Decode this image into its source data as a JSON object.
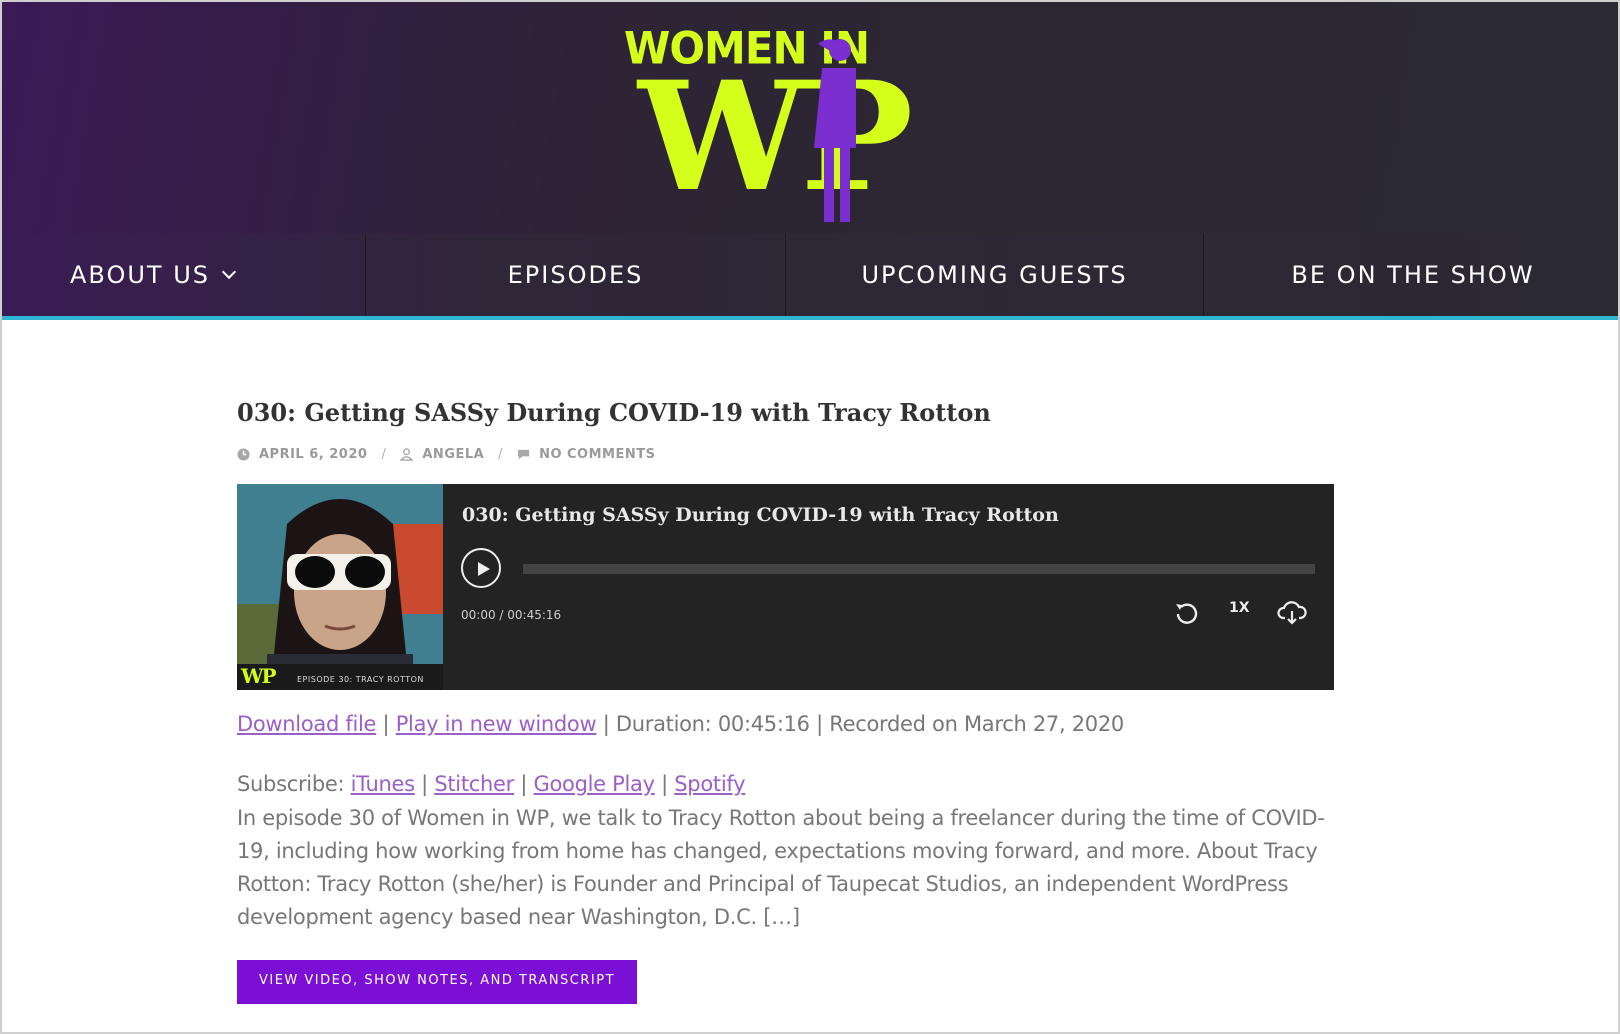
{
  "header": {
    "logo_small_text": "WOMEN IN",
    "logo_big_text": "WP",
    "colors": {
      "logo_green": "#d4ff1a",
      "logo_purple": "#7b2fd0",
      "accent_line": "#2fb6d2"
    }
  },
  "nav": {
    "items": [
      {
        "label": "ABOUT US",
        "has_dropdown": true
      },
      {
        "label": "EPISODES"
      },
      {
        "label": "UPCOMING GUESTS"
      },
      {
        "label": "BE ON THE SHOW"
      }
    ]
  },
  "post": {
    "title": "030: Getting SASSy During COVID-19 with Tracy Rotton",
    "date": "APRIL 6, 2020",
    "author": "ANGELA",
    "comments": "NO COMMENTS",
    "icons": {
      "date": "clock-icon",
      "author": "user-icon",
      "comments": "comment-icon"
    }
  },
  "player": {
    "title": "030: Getting SASSy During COVID-19 with Tracy Rotton",
    "time_display": "00:00 / 00:45:16",
    "speed": "1X",
    "progress": 0,
    "cover_caption": "EPISODE 30: TRACY ROTTON",
    "cover_logo": "WP",
    "icons": {
      "play": "play-icon",
      "rewind": "replay-icon",
      "download": "cloud-download-icon"
    }
  },
  "links": {
    "download": "Download file",
    "sep1": " | ",
    "play_new": "Play in new window",
    "rest": " | Duration: 00:45:16 | Recorded on March 27, 2020"
  },
  "subscribe": {
    "label": "Subscribe: ",
    "itunes": "iTunes",
    "stitcher": "Stitcher",
    "google": "Google Play",
    "spotify": "Spotify",
    "sep": " | "
  },
  "description": "In episode 30 of Women in WP, we talk to Tracy Rotton about being a freelancer during the time of COVID-19, including how working from home has changed, expectations moving forward, and more. About Tracy Rotton: Tracy Rotton (she/her) is Founder and Principal of Taupecat Studios, an independent WordPress development agency based near Washington, D.C. […]",
  "cta_label": "VIEW VIDEO, SHOW NOTES, AND TRANSCRIPT"
}
